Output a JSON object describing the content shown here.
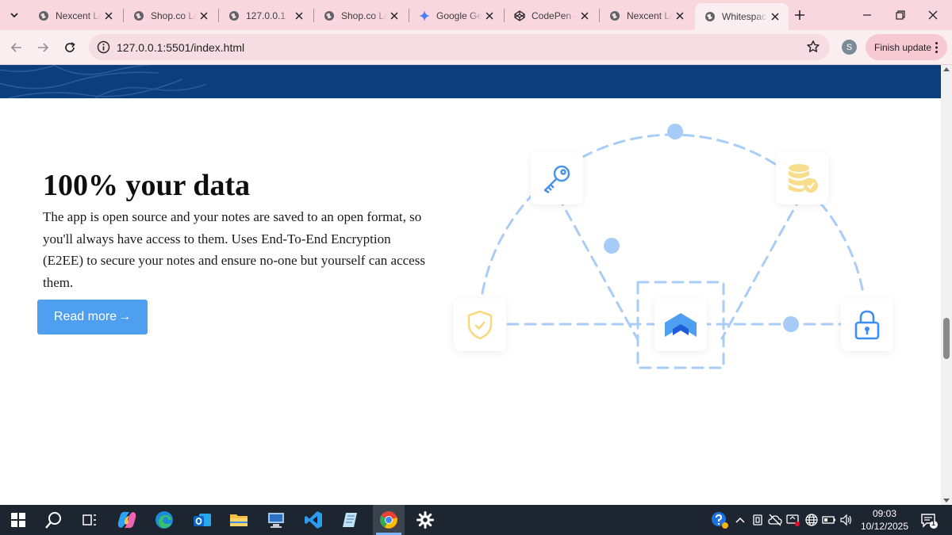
{
  "browser": {
    "tabs": [
      {
        "title": "Nexcent La",
        "favicon": "globe-icon"
      },
      {
        "title": "Shop.co La",
        "favicon": "globe-icon"
      },
      {
        "title": "127.0.0.1",
        "favicon": "globe-icon"
      },
      {
        "title": "Shop.co La",
        "favicon": "globe-icon"
      },
      {
        "title": "Google Ge",
        "favicon": "gemini-sparkle-icon"
      },
      {
        "title": "CodePen -",
        "favicon": "codepen-icon"
      },
      {
        "title": "Nexcent La",
        "favicon": "globe-icon"
      },
      {
        "title": "Whitespac",
        "favicon": "globe-icon",
        "active": true
      }
    ],
    "url": "127.0.0.1:5501/index.html",
    "profile_initial": "S",
    "finish_update_label": "Finish update"
  },
  "page": {
    "headline_prefix": "100% ",
    "headline_highlight": "your data",
    "body": "The app is open source and your notes are saved to an open format, so you'll always have access to them. Uses End-To-End Encryption (E2EE) to secure your notes and ensure no-one but yourself can access them.",
    "read_more_label": "Read more",
    "read_more_arrow": "→",
    "illustration_icons": [
      "key-icon",
      "database-check-icon",
      "shield-check-icon",
      "whitespace-logo-icon",
      "padlock-icon"
    ]
  },
  "taskbar": {
    "time": "09:03",
    "date": "10/12/2025",
    "notification_count": "1"
  },
  "colors": {
    "hero_band": "#0c3d7d",
    "button": "#4f9ff1",
    "highlight": "#f8dd8c",
    "dash": "#a9cdf6",
    "node": "#a5cbf6",
    "tab_strip": "#f9d7df"
  }
}
